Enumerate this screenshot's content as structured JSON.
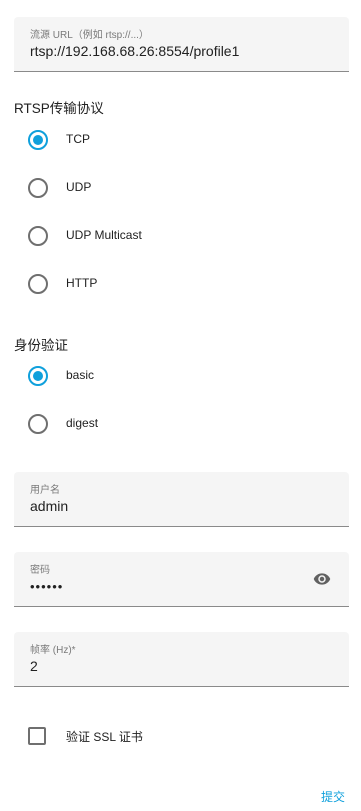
{
  "stream_url": {
    "label": "流源 URL（例如 rtsp://...）",
    "value": "rtsp://192.168.68.26:8554/profile1"
  },
  "rtsp_protocol": {
    "title": "RTSP传输协议",
    "options": [
      {
        "label": "TCP",
        "checked": true
      },
      {
        "label": "UDP",
        "checked": false
      },
      {
        "label": "UDP Multicast",
        "checked": false
      },
      {
        "label": "HTTP",
        "checked": false
      }
    ]
  },
  "auth": {
    "title": "身份验证",
    "options": [
      {
        "label": "basic",
        "checked": true
      },
      {
        "label": "digest",
        "checked": false
      }
    ]
  },
  "username": {
    "label": "用户名",
    "value": "admin"
  },
  "password": {
    "label": "密码",
    "value": "••••••"
  },
  "framerate": {
    "label": "帧率 (Hz)*",
    "value": "2"
  },
  "ssl": {
    "label": "验证 SSL 证书",
    "checked": false
  },
  "submit_label": "提交",
  "colors": {
    "accent": "#0fa0dc",
    "field_bg": "#f5f5f5",
    "text": "#212121"
  }
}
